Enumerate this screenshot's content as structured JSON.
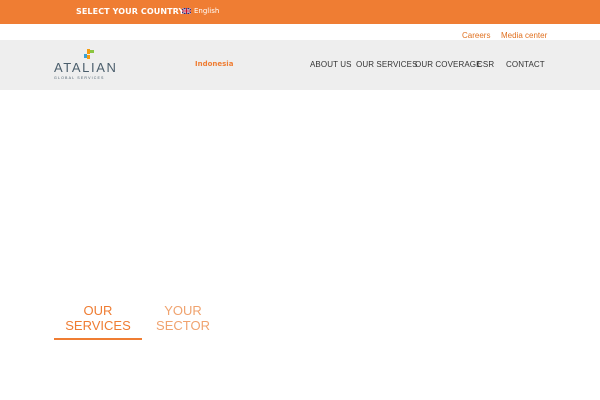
{
  "topbar": {
    "select_country": "SELECT YOUR COUNTRY",
    "language": "English",
    "language_flag_icon": "uk-flag-icon"
  },
  "utility_links": [
    "Careers",
    "Media center"
  ],
  "logo": {
    "name": "ATALIAN",
    "tagline": "GLOBAL SERVICES",
    "colors": [
      "#f39c12",
      "#8bc53f",
      "#3aa3d6"
    ]
  },
  "header": {
    "region": "Indonesia"
  },
  "nav": {
    "items": [
      "ABOUT US",
      "OUR SERVICES",
      "OUR COVERAGE",
      "CSR",
      "CONTACT"
    ]
  },
  "tabs": {
    "services_line1": "OUR",
    "services_line2": "SERVICES",
    "sector_line1": "YOUR",
    "sector_line2": "SECTOR"
  },
  "colors": {
    "accent": "#ef7d33",
    "header_bg": "#eeeeee",
    "logo_text": "#4b5e6c"
  }
}
